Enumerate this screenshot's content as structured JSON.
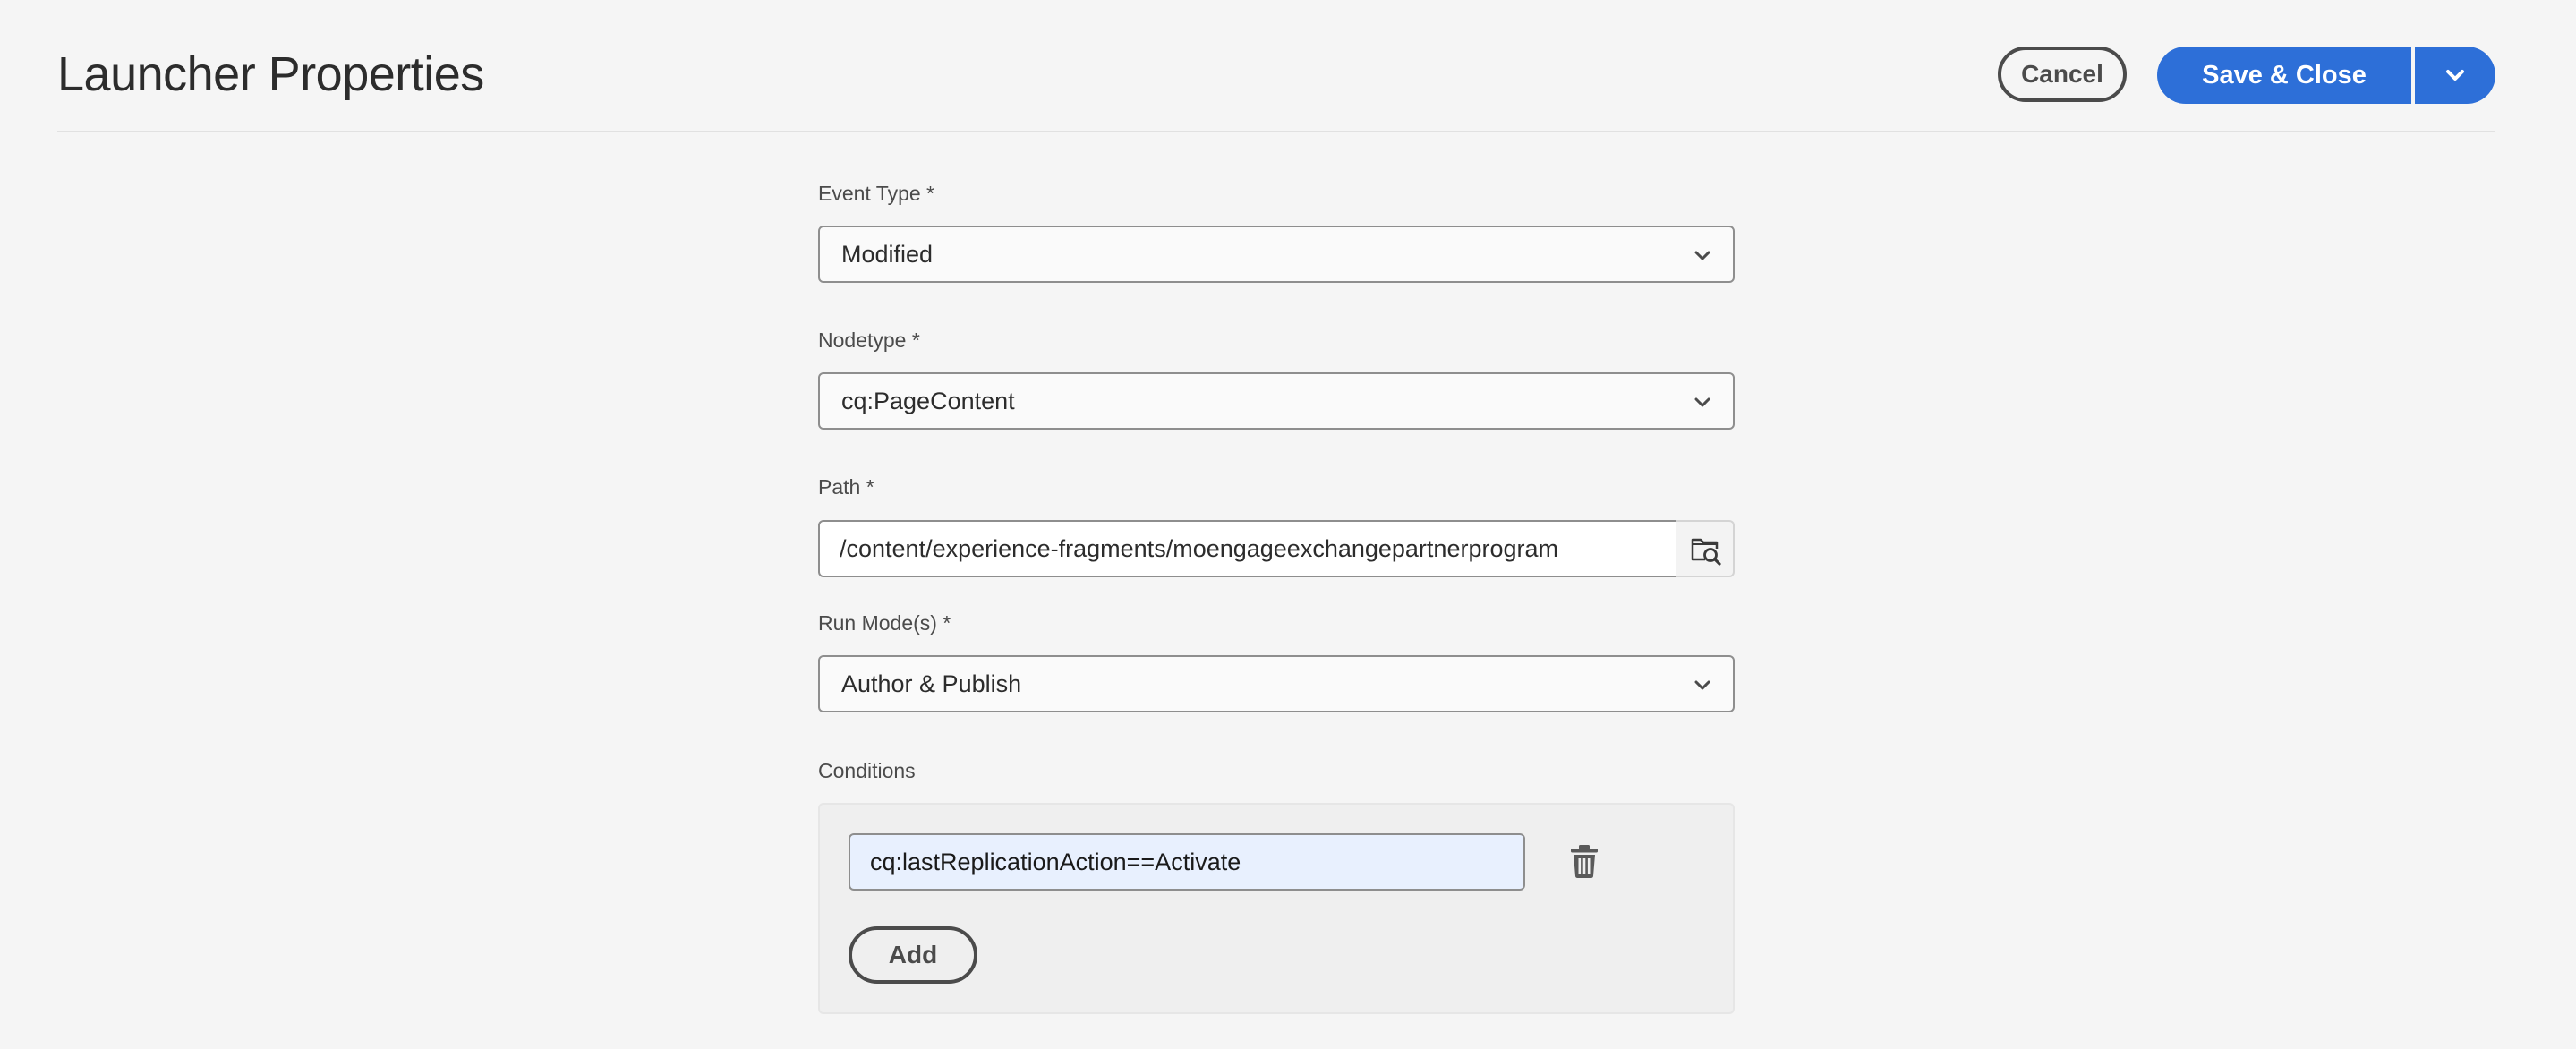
{
  "header": {
    "title": "Launcher Properties",
    "cancel_label": "Cancel",
    "save_label": "Save & Close"
  },
  "form": {
    "event_type": {
      "label": "Event Type *",
      "value": "Modified"
    },
    "nodetype": {
      "label": "Nodetype *",
      "value": "cq:PageContent"
    },
    "path": {
      "label": "Path *",
      "value": "/content/experience-fragments/moengageexchangepartnerprogram"
    },
    "run_modes": {
      "label": "Run Mode(s) *",
      "value": "Author & Publish"
    },
    "conditions": {
      "label": "Conditions",
      "items": [
        {
          "value": "cq:lastReplicationAction==Activate"
        }
      ],
      "add_label": "Add"
    }
  },
  "colors": {
    "background": "#f5f5f5",
    "primary": "#2d6fd8",
    "autofill_input": "#e8f0fe"
  },
  "icons": {
    "dropdown": "chevron-down-icon",
    "browse": "folder-search-icon",
    "delete": "trash-icon"
  }
}
